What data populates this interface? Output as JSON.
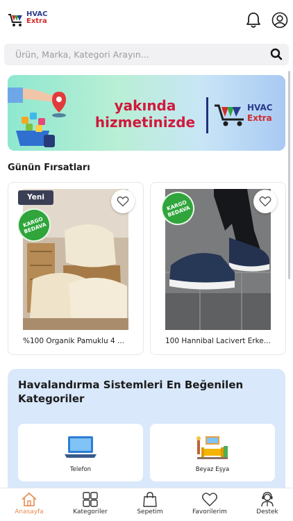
{
  "header": {
    "logo_line1": "HVAC",
    "logo_line2": "Extra",
    "notification_icon": "bell-icon",
    "profile_icon": "user-icon"
  },
  "search": {
    "placeholder": "Ürün, Marka, Kategori Arayın...",
    "icon": "search-icon"
  },
  "banner": {
    "line1": "yakında",
    "line2": "hizmetinizde",
    "logo_line1": "HVAC",
    "logo_line2": "Extra"
  },
  "deals": {
    "title": "Günün Fırsatları",
    "products": [
      {
        "name": "%100 Organik Pamuklu 4 ...",
        "badge_new": "Yeni",
        "badge_shipping_1": "KARGO",
        "badge_shipping_2": "BEDAVA"
      },
      {
        "name": "100 Hannibal Lacivert Erke...",
        "badge_shipping_1": "KARGO",
        "badge_shipping_2": "BEDAVA"
      }
    ]
  },
  "categories": {
    "title": "Havalandırma Sistemleri En Beğenilen Kategoriler",
    "items": [
      {
        "label": "Telefon",
        "icon": "laptop-icon"
      },
      {
        "label": "Beyaz Eşya",
        "icon": "living-room-icon"
      }
    ]
  },
  "bottom_nav": {
    "items": [
      {
        "label": "Anasayfa",
        "icon": "home-icon",
        "active": true
      },
      {
        "label": "Kategoriler",
        "icon": "grid-icon"
      },
      {
        "label": "Sepetim",
        "icon": "shopping-bag-icon"
      },
      {
        "label": "Favorilerim",
        "icon": "heart-icon"
      },
      {
        "label": "Destek",
        "icon": "support-agent-icon"
      }
    ]
  },
  "colors": {
    "accent": "#e88a4a",
    "shipping_badge": "#2fa53b",
    "banner_text": "#d0193c",
    "category_bg": "#d9e8fb"
  }
}
